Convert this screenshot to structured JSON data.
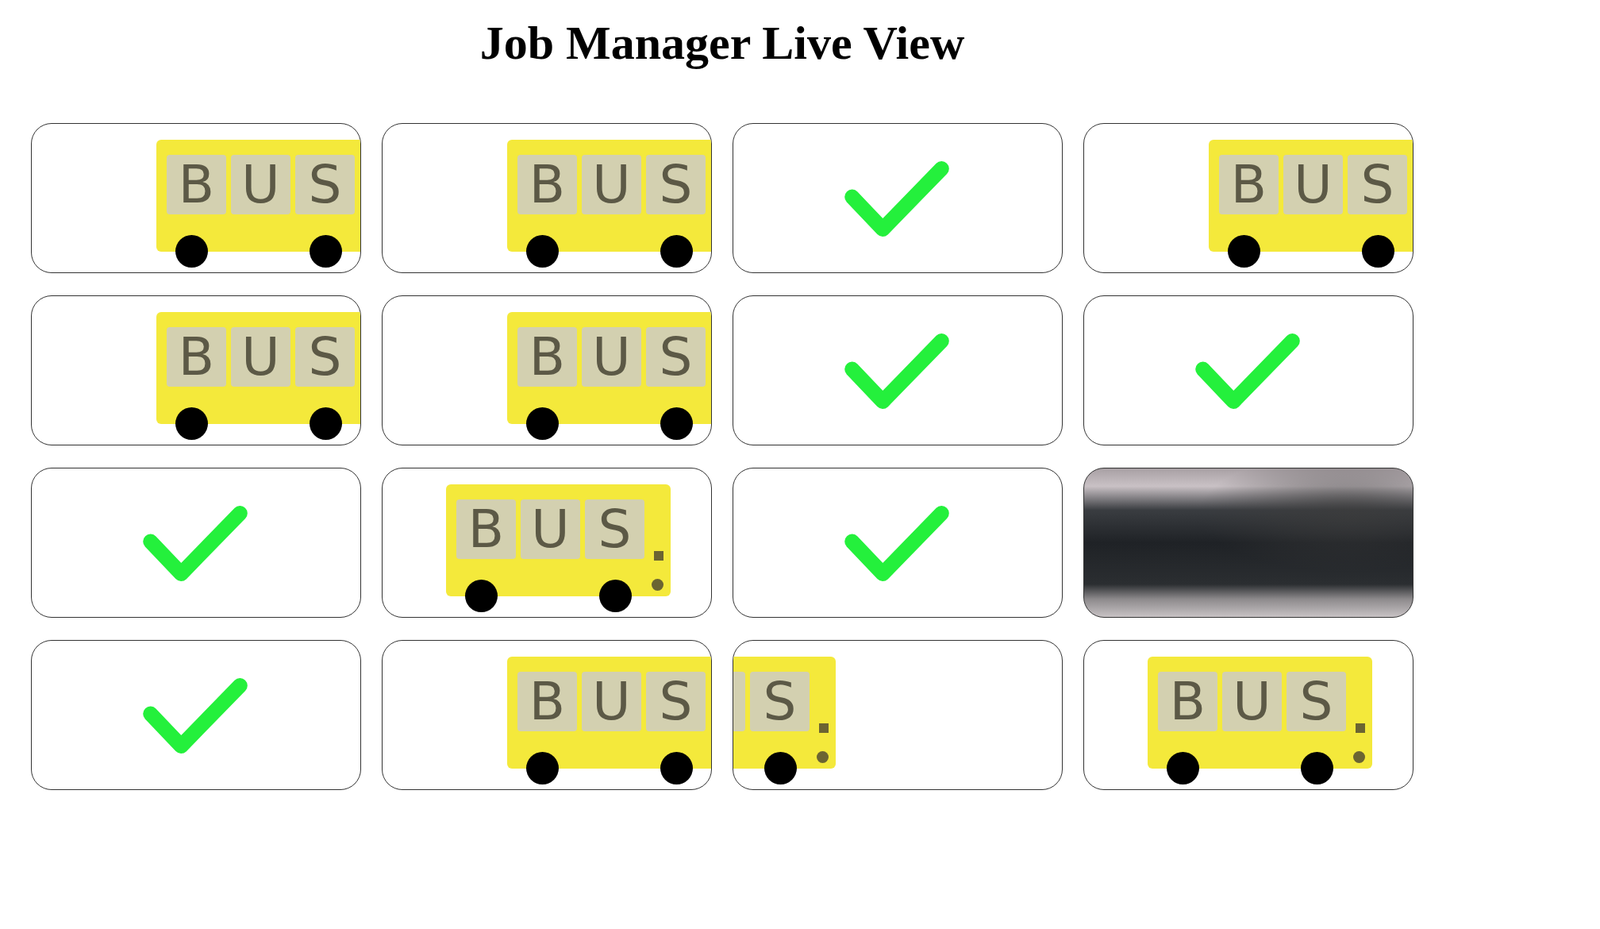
{
  "title": "Job Manager Live View",
  "jobs": [
    {
      "kind": "bus",
      "level": 0.63,
      "letters": [
        "B",
        "U",
        "S"
      ]
    },
    {
      "kind": "bus",
      "level": 0.63,
      "letters": [
        "B",
        "U",
        "S"
      ]
    },
    {
      "kind": "check"
    },
    {
      "kind": "bus",
      "level": 0.63,
      "letters": [
        "B",
        "U",
        "S"
      ]
    },
    {
      "kind": "bus",
      "level": 0.63,
      "letters": [
        "B",
        "U",
        "S"
      ]
    },
    {
      "kind": "bus",
      "level": 0.63,
      "letters": [
        "B",
        "U",
        "S"
      ]
    },
    {
      "kind": "check"
    },
    {
      "kind": "check"
    },
    {
      "kind": "check"
    },
    {
      "kind": "bus",
      "level": 0.52,
      "letters": [
        "B",
        "U",
        "S"
      ]
    },
    {
      "kind": "check"
    },
    {
      "kind": "photo"
    },
    {
      "kind": "check"
    },
    {
      "kind": "bus",
      "level": 0.63,
      "letters": [
        "B",
        "U",
        "S"
      ]
    },
    {
      "kind": "bus",
      "level": 0.185,
      "letters": [
        "S"
      ]
    },
    {
      "kind": "bus",
      "level": 0.52,
      "letters": [
        "B",
        "U",
        "S"
      ]
    }
  ]
}
